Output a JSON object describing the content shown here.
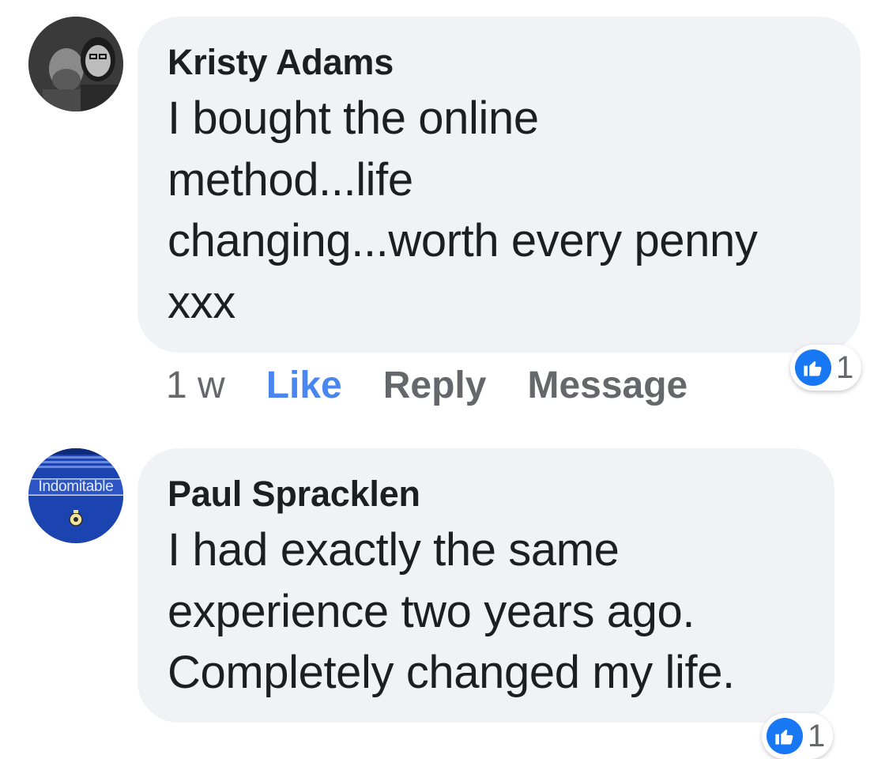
{
  "colors": {
    "bubble_bg": "#f0f2f5",
    "like_blue": "#4b86f0",
    "reaction_blue": "#1877f2",
    "muted_text": "#65676b",
    "main_text": "#1c1e21"
  },
  "comments": [
    {
      "author": "Kristy Adams",
      "text_lines": [
        "I bought the online",
        "method...life",
        "changing...worth every penny",
        "xxx"
      ],
      "time": "1 w",
      "like_label": "Like",
      "reply_label": "Reply",
      "message_label": "Message",
      "reaction_icon": "thumbs-up-icon",
      "reaction_count": "1"
    },
    {
      "author": "Paul Spracklen",
      "avatar_text": "Indomitable",
      "text_lines": [
        "I had exactly the same",
        "experience two years ago.",
        "Completely changed my life."
      ],
      "reaction_icon": "thumbs-up-icon",
      "reaction_count": "1"
    }
  ]
}
